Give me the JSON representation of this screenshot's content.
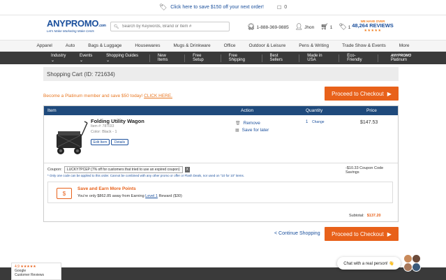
{
  "topbar": {
    "promo": "Click here to save $150 off your next order!",
    "inbox_count": "0"
  },
  "header": {
    "brand_a": "ANY",
    "brand_b": "PROMO",
    "brand_suffix": ".com",
    "tagline": "Let's Make Marketing Make Cents",
    "search_placeholder": "Search by Keywords, Brand or Item #",
    "phone": "1-888-369-9885",
    "user": "Jhon",
    "cart_count": "1",
    "tags_count": "1",
    "reviews_pre": "WE HAVE OVER",
    "reviews_count": "48,264 REVIEWS",
    "reviews_stars": "★★★★★"
  },
  "categories": [
    "Apparel",
    "Auto",
    "Bags & Luggage",
    "Housewares",
    "Mugs & Drinkware",
    "Office",
    "Outdoor & Leisure",
    "Pens & Writing",
    "Trade Show & Events",
    "More"
  ],
  "darknav": {
    "industry": "Industry ⌄",
    "events": "Events ⌄",
    "guides": "Shopping Guides ⌄",
    "new_items": "New Items",
    "free_setup": "Free Setup",
    "free_shipping": "Free Shipping",
    "best_sellers": "Best Sellers",
    "made_usa": "Made in USA",
    "eco": "Eco-Friendly",
    "platinum_brand": "ANYPROMO",
    "platinum_label": "Platinum"
  },
  "cart": {
    "title": "Shopping Cart (ID: 721634)",
    "promo_text": "Become a Platinum member and save $50 today!",
    "promo_link": "CLICK HERE.",
    "checkout_label": "Proceed to Checkout",
    "columns": {
      "item": "Item",
      "action": "Action",
      "quantity": "Quantity",
      "price": "Price"
    },
    "product": {
      "name": "Folding Utility Wagon",
      "item_no": "Item #: 787033",
      "color": "Color: Black - 1",
      "edit": "Edit Item",
      "details": "Details",
      "remove": "Remove",
      "save": "Save for later",
      "qty": "1",
      "change": "Change",
      "price": "$147.53"
    },
    "coupon": {
      "label": "Coupon:",
      "code": "LUCKY7PCEP (7% off for customers that tried to use an expired coupon)",
      "remove": "X",
      "savings": "-$10.33 Coupon Code Savings",
      "note": "* Only one code can be applied to this order. Cannot be combined with any other promo or offer or Flash Deals, nor used on \"10 for 10\" items."
    },
    "earn": {
      "title": "Save and Earn More Points",
      "text_a": "You're only $862.85 away from Earning ",
      "level": "Level 1",
      "text_b": " Reward ($30)"
    },
    "subtotal_label": "Subtotal:",
    "subtotal_value": "$137.20",
    "continue": "< Continue Shopping"
  },
  "widgets": {
    "google_rating": "4.9 ★★★★★",
    "google_label": "Google",
    "google_reviews": "Customer Reviews",
    "chat": "Chat with a real person! 👋"
  }
}
